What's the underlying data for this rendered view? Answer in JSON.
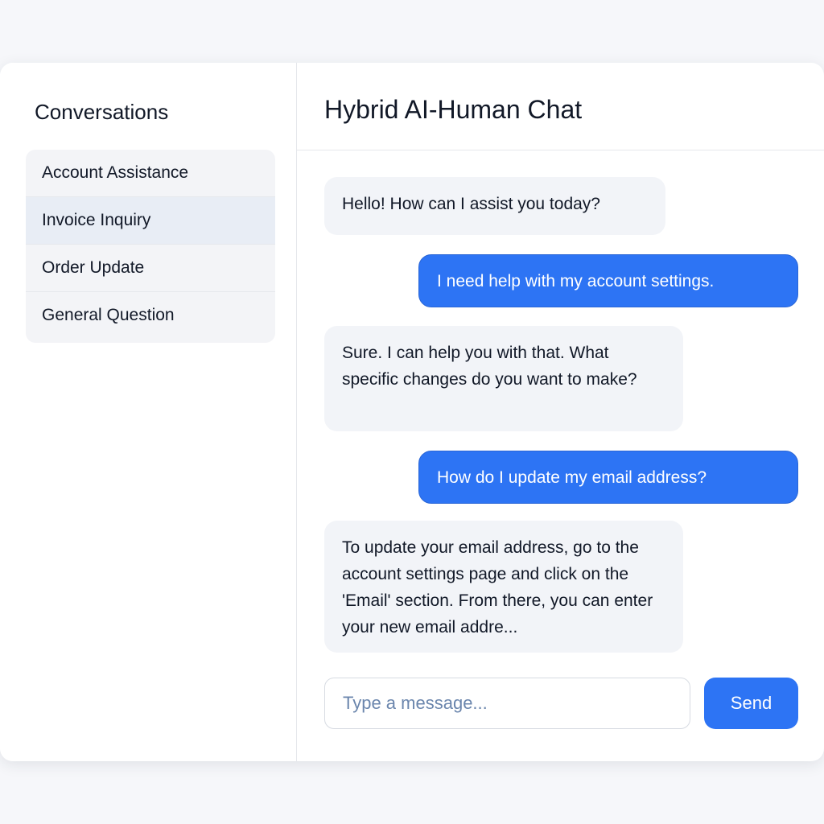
{
  "sidebar": {
    "title": "Conversations",
    "items": [
      {
        "label": "Account Assistance"
      },
      {
        "label": "Invoice Inquiry"
      },
      {
        "label": "Order Update"
      },
      {
        "label": "General Question"
      }
    ],
    "active_index": 1
  },
  "chat": {
    "title": "Hybrid AI-Human Chat",
    "messages": [
      {
        "sender": "bot",
        "text": "Hello! How can I assist you today?"
      },
      {
        "sender": "user",
        "text": "I need help with my  account settings."
      },
      {
        "sender": "bot",
        "text": "Sure. I can help you with that. What specific changes do you want to make?"
      },
      {
        "sender": "user",
        "text": "How do I update my email address?"
      },
      {
        "sender": "bot",
        "text": "To update your email address, go to the account settings page and click on the 'Email' section. From there, you can enter your new email addre..."
      }
    ]
  },
  "composer": {
    "placeholder": "Type a message...",
    "value": "",
    "send_label": "Send"
  },
  "colors": {
    "accent": "#2d74f4",
    "bot_bubble": "#f2f4f8",
    "active_item": "#e8edf5"
  }
}
